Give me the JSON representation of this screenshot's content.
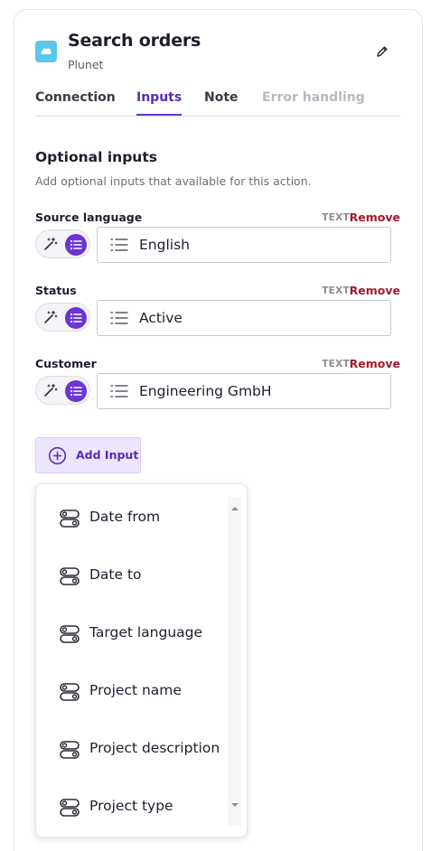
{
  "header": {
    "title": "Search orders",
    "subtitle": "Plunet",
    "app_icon": "plunet-app-icon",
    "edit_icon": "pencil-icon"
  },
  "tabs": [
    {
      "label": "Connection",
      "state": "normal"
    },
    {
      "label": "Inputs",
      "state": "active"
    },
    {
      "label": "Note",
      "state": "normal"
    },
    {
      "label": "Error handling",
      "state": "disabled"
    }
  ],
  "optional_inputs": {
    "title": "Optional inputs",
    "description": "Add optional inputs that available for this action."
  },
  "fields": [
    {
      "label": "Source language",
      "type": "TEXT",
      "remove_label": "Remove",
      "value": "English"
    },
    {
      "label": "Status",
      "type": "TEXT",
      "remove_label": "Remove",
      "value": "Active"
    },
    {
      "label": "Customer",
      "type": "TEXT",
      "remove_label": "Remove",
      "value": "Engineering GmbH"
    }
  ],
  "add_input": {
    "label": "Add Input",
    "icon": "plus-circle-icon"
  },
  "dropdown": {
    "items": [
      {
        "label": "Date from",
        "icon": "toggle-input-icon"
      },
      {
        "label": "Date to",
        "icon": "toggle-input-icon"
      },
      {
        "label": "Target language",
        "icon": "toggle-input-icon"
      },
      {
        "label": "Project name",
        "icon": "toggle-input-icon"
      },
      {
        "label": "Project description",
        "icon": "toggle-input-icon"
      },
      {
        "label": "Project type",
        "icon": "toggle-input-icon"
      }
    ]
  },
  "colors": {
    "accent": "#6a35d4",
    "accent_text": "#5b2bb8",
    "remove": "#a11b2e",
    "app_icon_bg": "#5cc6ec",
    "add_input_bg": "#ece5fb"
  }
}
